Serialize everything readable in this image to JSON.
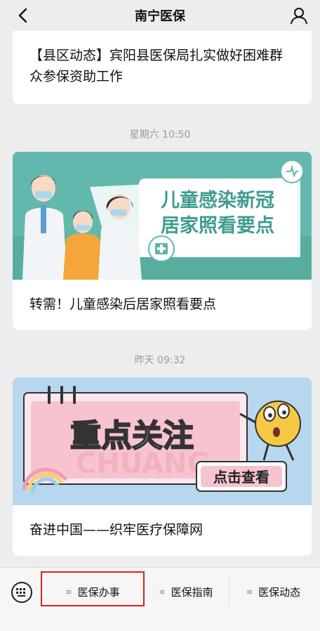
{
  "header": {
    "title": "南宁医保"
  },
  "articles": [
    {
      "headline": "【县区动态】宾阳县医保局扎实做好困难群众参保资助工作"
    },
    {
      "time": "星期六 10:50",
      "cover_title_line1": "儿童感染新冠",
      "cover_title_line2": "居家照看要点",
      "headline": "转需！儿童感染后居家照看要点"
    },
    {
      "time": "昨天 09:32",
      "cover_title": "重点关注",
      "cover_button": "点击查看",
      "cover_watermark": "CHUANG",
      "headline": "奋进中国——织牢医疗保障网"
    }
  ],
  "menu": [
    {
      "label": "医保办事"
    },
    {
      "label": "医保指南"
    },
    {
      "label": "医保动态"
    }
  ],
  "colors": {
    "teal": "#5ab5a8",
    "pink": "#f3b9c8",
    "yellow": "#f6c945",
    "highlight": "#e02020"
  }
}
